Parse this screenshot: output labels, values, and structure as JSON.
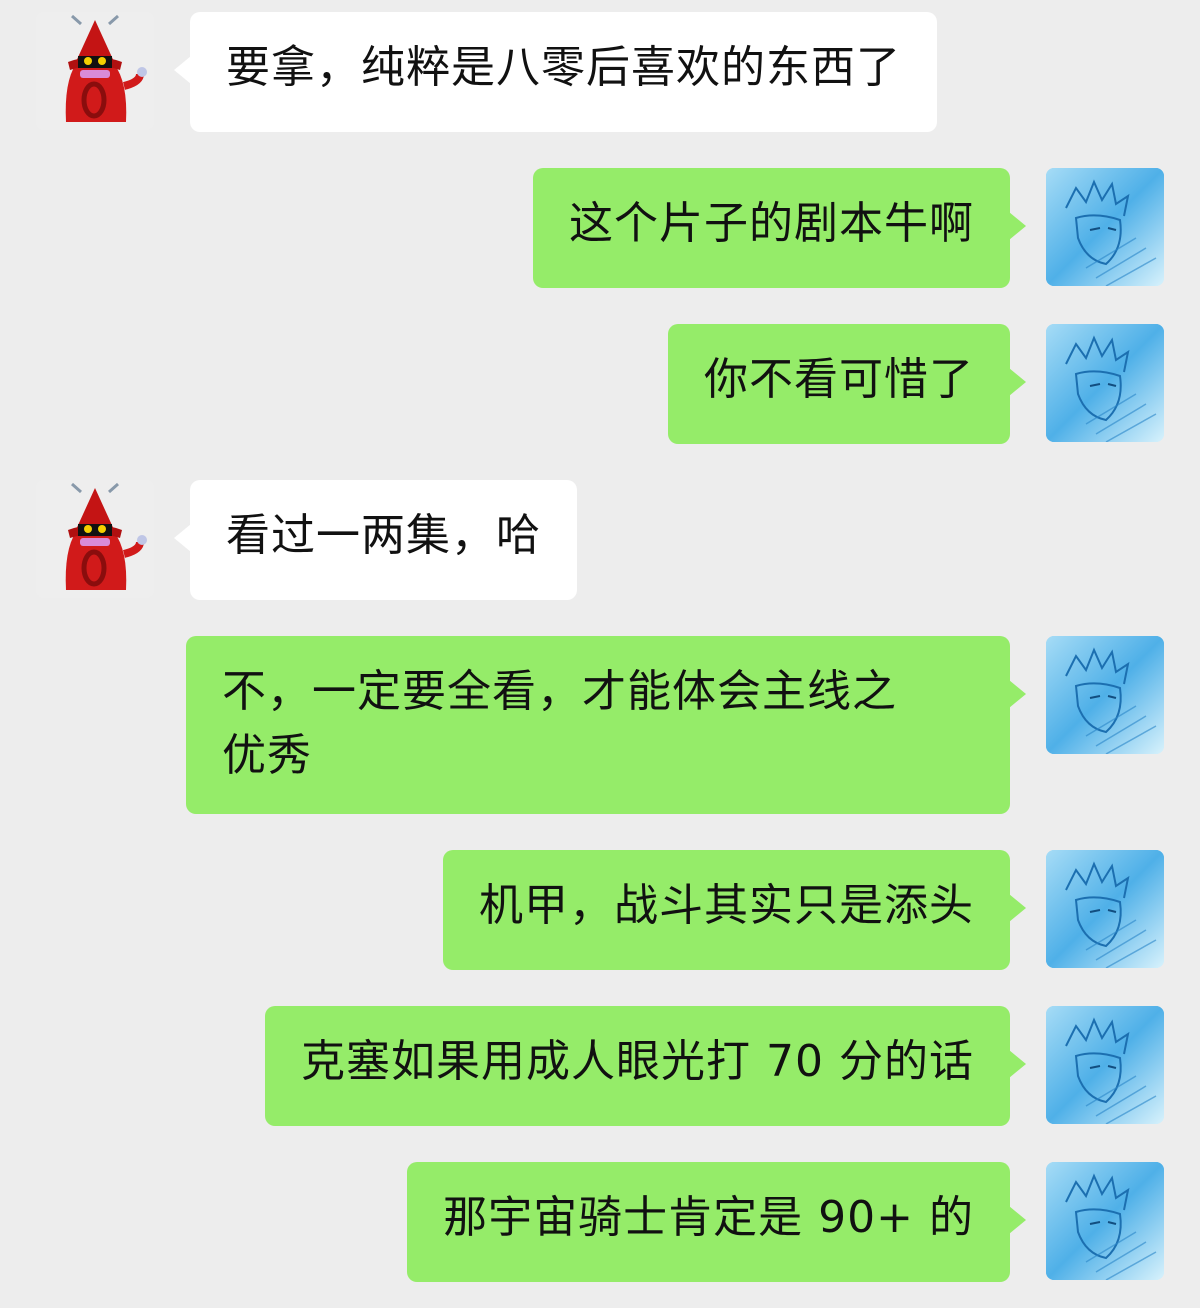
{
  "messages": [
    {
      "side": "left",
      "text": "要拿，纯粹是八零后喜欢的东西了"
    },
    {
      "side": "right",
      "text": "这个片子的剧本牛啊"
    },
    {
      "side": "right",
      "text": "你不看可惜了"
    },
    {
      "side": "left",
      "text": "看过一两集，哈"
    },
    {
      "side": "right",
      "text": "不，一定要全看，才能体会主线之\n优秀"
    },
    {
      "side": "right",
      "text": "机甲，战斗其实只是添头"
    },
    {
      "side": "right",
      "text": "克塞如果用成人眼光打 70 分的话"
    },
    {
      "side": "right",
      "text": "那宇宙骑士肯定是 90+ 的"
    }
  ],
  "avatars": {
    "left": "red-wizard-character-icon",
    "right": "blue-anime-sketch-icon"
  },
  "colors": {
    "background": "#ededed",
    "sent_bubble": "#95ec69",
    "received_bubble": "#ffffff",
    "text": "#111111"
  }
}
